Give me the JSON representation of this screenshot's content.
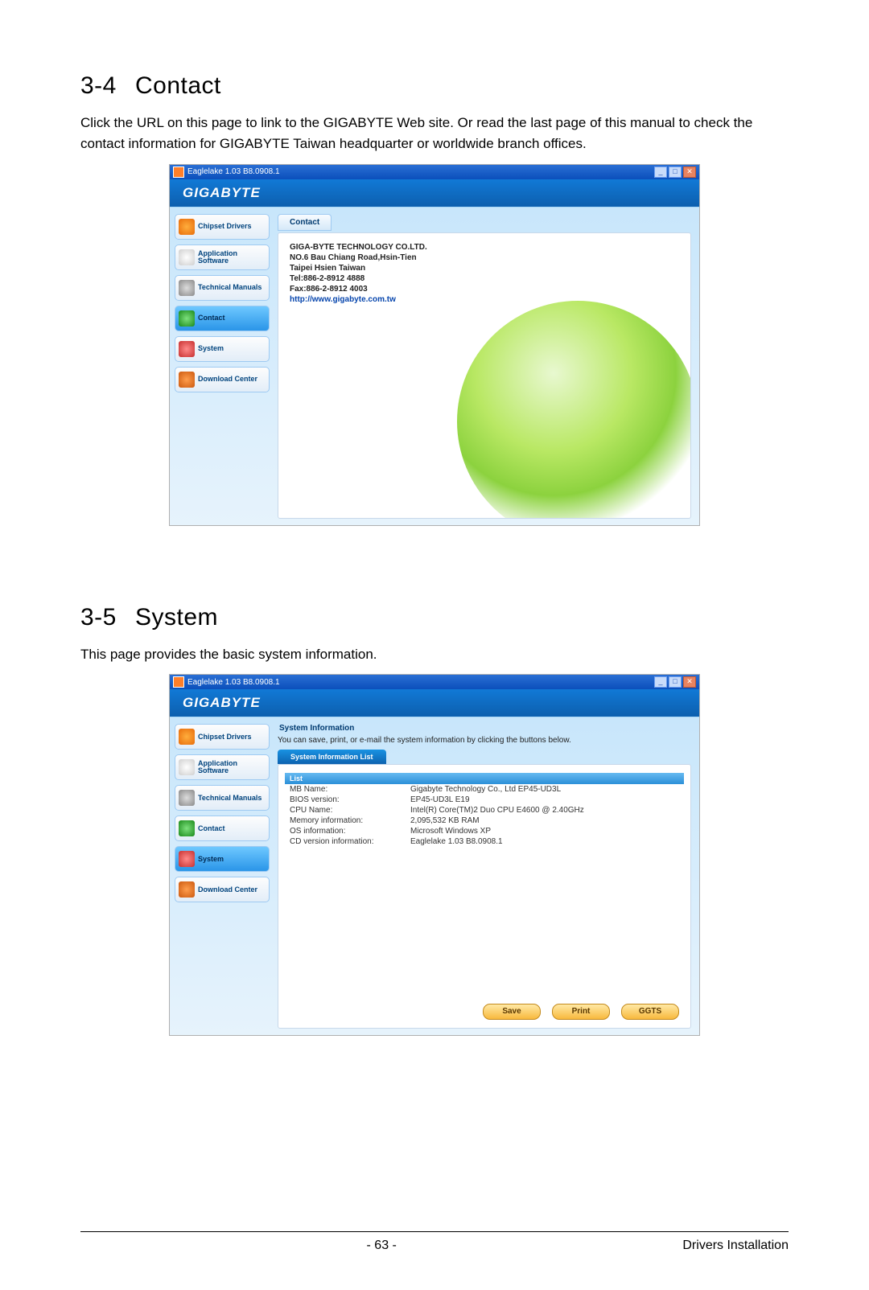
{
  "sections": {
    "contact": {
      "num": "3-4",
      "title": "Contact",
      "body": "Click the URL on this page to link to the GIGABYTE Web site. Or read the last page of this manual to check the contact information for GIGABYTE Taiwan headquarter or worldwide branch offices."
    },
    "system": {
      "num": "3-5",
      "title": "System",
      "body": "This page provides the basic system information."
    }
  },
  "window": {
    "title": "Eaglelake 1.03 B8.0908.1",
    "brand": "GIGABYTE"
  },
  "nav": {
    "chipset": "Chipset Drivers",
    "app": "Application Software",
    "tech": "Technical Manuals",
    "contact": "Contact",
    "system": "System",
    "download": "Download Center"
  },
  "contactPanel": {
    "tab": "Contact",
    "company": "GIGA-BYTE TECHNOLOGY CO.LTD.",
    "addr1": "NO.6 Bau Chiang Road,Hsin-Tien",
    "addr2": "Taipei Hsien Taiwan",
    "tel": "Tel:886-2-8912 4888",
    "fax": "Fax:886-2-8912 4003",
    "url": "http://www.gigabyte.com.tw"
  },
  "systemPanel": {
    "heading": "System Information",
    "desc": "You can save, print, or e-mail the system information by clicking the buttons below.",
    "tab": "System Information List",
    "gridhead": "List",
    "rows": [
      {
        "k": "MB Name:",
        "v": "Gigabyte Technology Co., Ltd EP45-UD3L"
      },
      {
        "k": "BIOS version:",
        "v": "EP45-UD3L E19"
      },
      {
        "k": "CPU Name:",
        "v": "Intel(R) Core(TM)2 Duo CPU E4600 @ 2.40GHz"
      },
      {
        "k": "Memory information:",
        "v": "2,095,532 KB RAM"
      },
      {
        "k": "OS information:",
        "v": "Microsoft Windows XP"
      },
      {
        "k": "CD version information:",
        "v": "Eaglelake 1.03 B8.0908.1"
      }
    ],
    "buttons": {
      "save": "Save",
      "print": "Print",
      "ggts": "GGTS"
    }
  },
  "footer": {
    "page": "- 63 -",
    "section": "Drivers Installation"
  }
}
